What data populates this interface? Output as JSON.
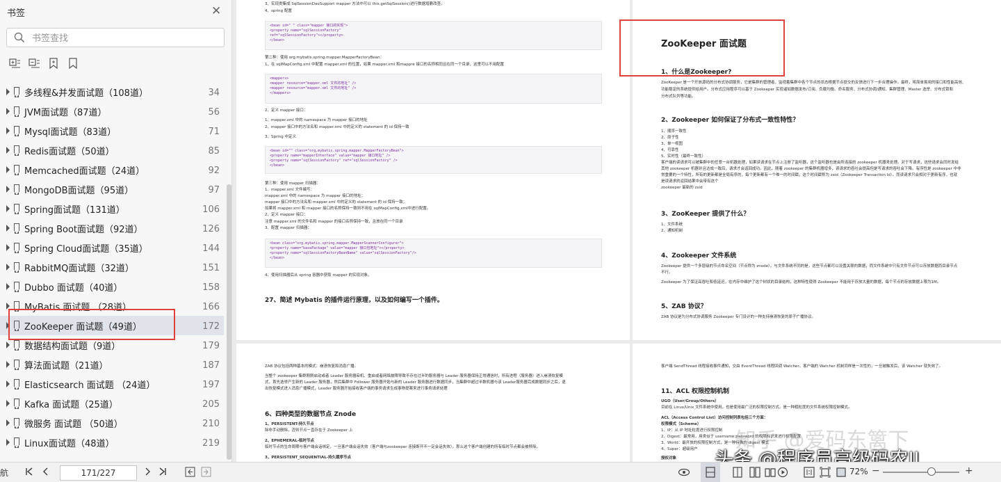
{
  "sidebar": {
    "title": "书签",
    "search_placeholder": "书签查找",
    "items": [
      {
        "label": "多线程&并发面试题（108道）",
        "page": "34"
      },
      {
        "label": "JVM面试题（87道）",
        "page": "56"
      },
      {
        "label": "Mysql面试题（83道）",
        "page": "71"
      },
      {
        "label": "Redis面试题（50道）",
        "page": "85"
      },
      {
        "label": "Memcached面试题（24道）",
        "page": "92"
      },
      {
        "label": "MongoDB面试题（95道）",
        "page": "97"
      },
      {
        "label": "Spring面试题（131道）",
        "page": "106"
      },
      {
        "label": "Spring Boot面试题（92道）",
        "page": "126"
      },
      {
        "label": "Spring Cloud面试题（35道）",
        "page": "144"
      },
      {
        "label": "RabbitMQ面试题（32道）",
        "page": "151"
      },
      {
        "label": "Dubbo 面试题（40道）",
        "page": "158"
      },
      {
        "label": "MyBatis 面试题 （28道）",
        "page": "166"
      },
      {
        "label": "ZooKeeper 面试题（49道）",
        "page": "172"
      },
      {
        "label": "数据结构面试题（9道）",
        "page": "179"
      },
      {
        "label": "算法面试题（21道）",
        "page": "187"
      },
      {
        "label": "Elasticsearch 面试题 （24道）",
        "page": "197"
      },
      {
        "label": "Kafka 面试题（25道）",
        "page": "205"
      },
      {
        "label": "微服务 面试题 （50道）",
        "page": "210"
      },
      {
        "label": "Linux面试题（48道）",
        "page": "219"
      }
    ]
  },
  "bottombar": {
    "left_fragment": "航",
    "page_value": "171/227",
    "zoom": "72%"
  },
  "colors": {
    "highlight_box": "#e0403a",
    "selected_row": "#dfe3ea"
  },
  "pages": {
    "p1": {
      "lines": [
        "3、实现类集成 SqlSessionDaoSupport mapper 方法中可以 this.getSqlSession()进行数据增删改查。",
        "4、spring 配置",
        "第二种：使用 org.mybatis.spring.mapper.MapperFactoryBean：",
        "1、在 sqlMapConfig.xml 中配置 mapper.xml 的位置，如果 mapper.xml 和mappre 接口的名称相同且在同一个目录，这里可以不用配置",
        "2、定义 mapper 接口：",
        "1、mapper.xml 中的 namespace 为 mapper 接口的地址",
        "2、mapper 接口中的方法名和 mapper.xml 中的定义的 statement 的 id 保持一致",
        "3、Spring 中定义",
        "第三种：使用 mapper 扫描器：",
        "1、mapper.xml 文件编写：",
        "mapper.xml 中的 namespace 为 mapper 接口的地址；",
        "mapper 接口中的方法名和 mapper.xml 中的定义的 statement 的 id 保持一致；",
        "如果将 mapper.xml 和 mapper 接口的名称保持一致则不用在 sqlMapConfig.xml中进行配置。",
        "2、定义 mapper 接口：",
        "注意 mapper.xml 的文件名和 mapper 的接口名称保持一致，且放在同一个目录",
        "3、配置 mapper 扫描器：",
        "4、使用扫描器后从 spring 容器中获取 mapper 的实现对象。"
      ],
      "code1": "<bean id=\" \" class=\"mapper 接口的实现\">\n<property name=\"sqlSessionFactory\"\nref=\"sqlSessionFactory\"></property>\n</bean>",
      "code2": "<mappers>\n<mapper resource=\"mapper.xml 文件的地址\" />\n<mapper resource=\"mapper.xml 文件的地址\" />\n</mappers>",
      "code3": "<bean id=\"\" class=\"org.mybatis.spring.mapper.MapperFactoryBean\">\n<property name=\"mapperInterface\" value=\"mapper 接口地址\" />\n<property name=\"sqlSessionFactory\" ref=\"sqlSessionFactory\" />\n</bean>",
      "code4": "<bean class=\"org.mybatis.spring.mapper.MapperScannerConfigurer\">\n<property name=\"basePackage\" value=\"mapper 接口包地址\"></property>\n<property name=\"sqlSessionFactoryBeanName\" value=\"sqlSessionFactory\"/>\n</bean>",
      "heading": "27、简述 Mybatis 的插件运行原理，以及如何编写一个插件。"
    },
    "p2": {
      "title": "ZooKeeper 面试题",
      "h1": "1、什么是Zookeeper?",
      "h2": "2、Zookeeper 如何保证了分布式一致性特性？",
      "h3": "3、ZooKeeper 提供了什么？",
      "h4": "4、Zookeeper 文件系统",
      "h5": "5、ZAB 协议？",
      "lines": [
        "ZooKeeper 是一个开放源码的分布式协调服务，它是集群的管理者，监视着集群中各个节点的状态根据节点提交的反馈进行下一步合理操作。最终，将简单易用的接口和性能高效、",
        "功能稳定的系统提供给用户。分布式应用程序可以基于 Zookeeper 实现诸如数据发布/订阅、负载均衡、命名服务、分布式协调/通知、集群管理、Master 选举、分布式锁和",
        "分布式队列等功能。",
        "1、顺序一致性",
        "2、原子性",
        "3、单一视图",
        "4、可靠性",
        "5、实时性（最终一致性）",
        "客户端的读请求可以被集群中的任意一台机器处理，如果读请求在节点上注册了监听器，这个监听器也是由所连接的 zookeeper 机器来处理。对于写请求，这些请求会同时发给",
        "其他 zookeeper 机器并且达成一致后，请求才会返回成功。因此，随着 zookeeper 的集群机器增多，读请求的吞吐会提高但是写请求的吞吐会下降。有序性是 zookeeper 中非",
        "常重要的一个特性，所有的更新都是全局有序的，每个更新都有一个唯一的时间戳，这个时间戳称为 zxid（Zookeeper Transaction Id）。而读请求只会相对于更新有序，也就",
        "是读请求的返回结果中会带有这个",
        "zookeeper 最新的 zxid",
        "1、文件系统",
        "2、通知机制",
        "Zookeeper 提供一个多层级的节点命名空间（节点称为 znode）。与文件系统不同的是，这些节点都可以设置关联的数据，而文件系统中只有文件节点可以存放数据而目录节点",
        "不行。",
        "Zookeeper 为了保证高吞吐和低延迟，在内存中维护了这个树状的目录结构，这种特性使得 Zookeeper 不能用于存放大量的数据，每个节点的存放数据上限为1M。",
        "ZAB 协议是为分布式协调服务 Zookeeper 专门设计的一种支持崩溃恢复的原子广播协议。"
      ]
    },
    "p3": {
      "heading": "6、四种类型的数据节点 Znode",
      "lines": [
        "ZAB 协议包括两种基本的模式：崩溃恢复和消息广播。",
        "当整个 zookeeper 集群刚刚启动或者 Leader 服务器宕机、重启或者网络故障导致不存在过半的服务器与 Leader 服务器保持正常通信时，所有进程（服务器）进入崩溃恢复模",
        "式，首先选举产生新的 Leader 服务器，然后集群中 Follower 服务器开始与新的 Leader 服务器进行数据同步，当集群中超过半数机器与该 Leader服务器完成数据同步之后，退",
        "出恢复模式进入消息广播模式，Leader 服务器开始接收客户端的事务请求生成事物提案来进行事务请求处理",
        "1、PERSISTENT-持久节点",
        "除非手动删除，否则节点一直存在于 Zookeeper 上",
        "2、EPHEMERAL-临时节点",
        "临时节点的生命周期与客户端会话绑定，一旦客户端会话失效（客户端与zookeeper 连接断开不一定会话失效），那么这个客户端创建的所有临时节点都会被移除。",
        "3、PERSISTENT_SEQUENTIAL-持久顺序节点"
      ]
    },
    "p4": {
      "heading": "11、ACL 权限控制机制",
      "lines": [
        "客户端 SendThread 线程接收事件通知，交由 EventThread 线程回调 Watcher。客户端的 Watcher 机制同样是一次性的，一旦被触发后，该 Watcher 就失效了。",
        "UGO（User/Group/Others）",
        "目前在 Linux/Unix 文件系统中使用，也是使用最广泛的权限控制方式。是一种粗粒度的文件系统权限控制模式。",
        "ACL（Access Control List）访问控制列表包括三个方面：",
        "权限模式（Scheme）",
        "1、IP：从 IP 地址粒度进行权限控制",
        "2、Digest：最常用，用类似于 username:password 的权限标识来进行权限配置",
        "3、World：最开放的权限控制方式，是一种特殊的 digest 模式",
        "4、Super：超级用户",
        "授权对象"
      ]
    }
  },
  "watermark": {
    "zhihu": "知乎 @爱码东篱下",
    "toutiao": "头条 @程序员高级码农II"
  }
}
